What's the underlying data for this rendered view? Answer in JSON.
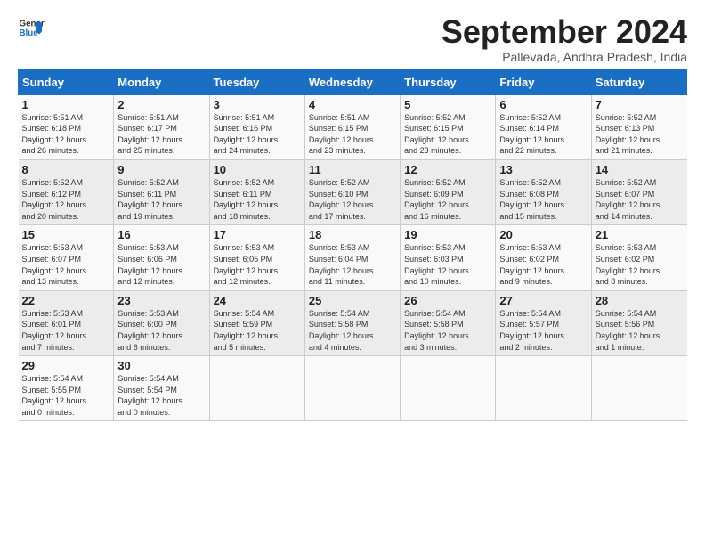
{
  "logo": {
    "line1": "General",
    "line2": "Blue"
  },
  "title": "September 2024",
  "subtitle": "Pallevada, Andhra Pradesh, India",
  "header": {
    "days": [
      "Sunday",
      "Monday",
      "Tuesday",
      "Wednesday",
      "Thursday",
      "Friday",
      "Saturday"
    ]
  },
  "rows": [
    [
      {
        "num": "1",
        "info": "Sunrise: 5:51 AM\nSunset: 6:18 PM\nDaylight: 12 hours\nand 26 minutes."
      },
      {
        "num": "2",
        "info": "Sunrise: 5:51 AM\nSunset: 6:17 PM\nDaylight: 12 hours\nand 25 minutes."
      },
      {
        "num": "3",
        "info": "Sunrise: 5:51 AM\nSunset: 6:16 PM\nDaylight: 12 hours\nand 24 minutes."
      },
      {
        "num": "4",
        "info": "Sunrise: 5:51 AM\nSunset: 6:15 PM\nDaylight: 12 hours\nand 23 minutes."
      },
      {
        "num": "5",
        "info": "Sunrise: 5:52 AM\nSunset: 6:15 PM\nDaylight: 12 hours\nand 23 minutes."
      },
      {
        "num": "6",
        "info": "Sunrise: 5:52 AM\nSunset: 6:14 PM\nDaylight: 12 hours\nand 22 minutes."
      },
      {
        "num": "7",
        "info": "Sunrise: 5:52 AM\nSunset: 6:13 PM\nDaylight: 12 hours\nand 21 minutes."
      }
    ],
    [
      {
        "num": "8",
        "info": "Sunrise: 5:52 AM\nSunset: 6:12 PM\nDaylight: 12 hours\nand 20 minutes."
      },
      {
        "num": "9",
        "info": "Sunrise: 5:52 AM\nSunset: 6:11 PM\nDaylight: 12 hours\nand 19 minutes."
      },
      {
        "num": "10",
        "info": "Sunrise: 5:52 AM\nSunset: 6:11 PM\nDaylight: 12 hours\nand 18 minutes."
      },
      {
        "num": "11",
        "info": "Sunrise: 5:52 AM\nSunset: 6:10 PM\nDaylight: 12 hours\nand 17 minutes."
      },
      {
        "num": "12",
        "info": "Sunrise: 5:52 AM\nSunset: 6:09 PM\nDaylight: 12 hours\nand 16 minutes."
      },
      {
        "num": "13",
        "info": "Sunrise: 5:52 AM\nSunset: 6:08 PM\nDaylight: 12 hours\nand 15 minutes."
      },
      {
        "num": "14",
        "info": "Sunrise: 5:52 AM\nSunset: 6:07 PM\nDaylight: 12 hours\nand 14 minutes."
      }
    ],
    [
      {
        "num": "15",
        "info": "Sunrise: 5:53 AM\nSunset: 6:07 PM\nDaylight: 12 hours\nand 13 minutes."
      },
      {
        "num": "16",
        "info": "Sunrise: 5:53 AM\nSunset: 6:06 PM\nDaylight: 12 hours\nand 12 minutes."
      },
      {
        "num": "17",
        "info": "Sunrise: 5:53 AM\nSunset: 6:05 PM\nDaylight: 12 hours\nand 12 minutes."
      },
      {
        "num": "18",
        "info": "Sunrise: 5:53 AM\nSunset: 6:04 PM\nDaylight: 12 hours\nand 11 minutes."
      },
      {
        "num": "19",
        "info": "Sunrise: 5:53 AM\nSunset: 6:03 PM\nDaylight: 12 hours\nand 10 minutes."
      },
      {
        "num": "20",
        "info": "Sunrise: 5:53 AM\nSunset: 6:02 PM\nDaylight: 12 hours\nand 9 minutes."
      },
      {
        "num": "21",
        "info": "Sunrise: 5:53 AM\nSunset: 6:02 PM\nDaylight: 12 hours\nand 8 minutes."
      }
    ],
    [
      {
        "num": "22",
        "info": "Sunrise: 5:53 AM\nSunset: 6:01 PM\nDaylight: 12 hours\nand 7 minutes."
      },
      {
        "num": "23",
        "info": "Sunrise: 5:53 AM\nSunset: 6:00 PM\nDaylight: 12 hours\nand 6 minutes."
      },
      {
        "num": "24",
        "info": "Sunrise: 5:54 AM\nSunset: 5:59 PM\nDaylight: 12 hours\nand 5 minutes."
      },
      {
        "num": "25",
        "info": "Sunrise: 5:54 AM\nSunset: 5:58 PM\nDaylight: 12 hours\nand 4 minutes."
      },
      {
        "num": "26",
        "info": "Sunrise: 5:54 AM\nSunset: 5:58 PM\nDaylight: 12 hours\nand 3 minutes."
      },
      {
        "num": "27",
        "info": "Sunrise: 5:54 AM\nSunset: 5:57 PM\nDaylight: 12 hours\nand 2 minutes."
      },
      {
        "num": "28",
        "info": "Sunrise: 5:54 AM\nSunset: 5:56 PM\nDaylight: 12 hours\nand 1 minute."
      }
    ],
    [
      {
        "num": "29",
        "info": "Sunrise: 5:54 AM\nSunset: 5:55 PM\nDaylight: 12 hours\nand 0 minutes."
      },
      {
        "num": "30",
        "info": "Sunrise: 5:54 AM\nSunset: 5:54 PM\nDaylight: 12 hours\nand 0 minutes."
      },
      {
        "num": "",
        "info": ""
      },
      {
        "num": "",
        "info": ""
      },
      {
        "num": "",
        "info": ""
      },
      {
        "num": "",
        "info": ""
      },
      {
        "num": "",
        "info": ""
      }
    ]
  ]
}
